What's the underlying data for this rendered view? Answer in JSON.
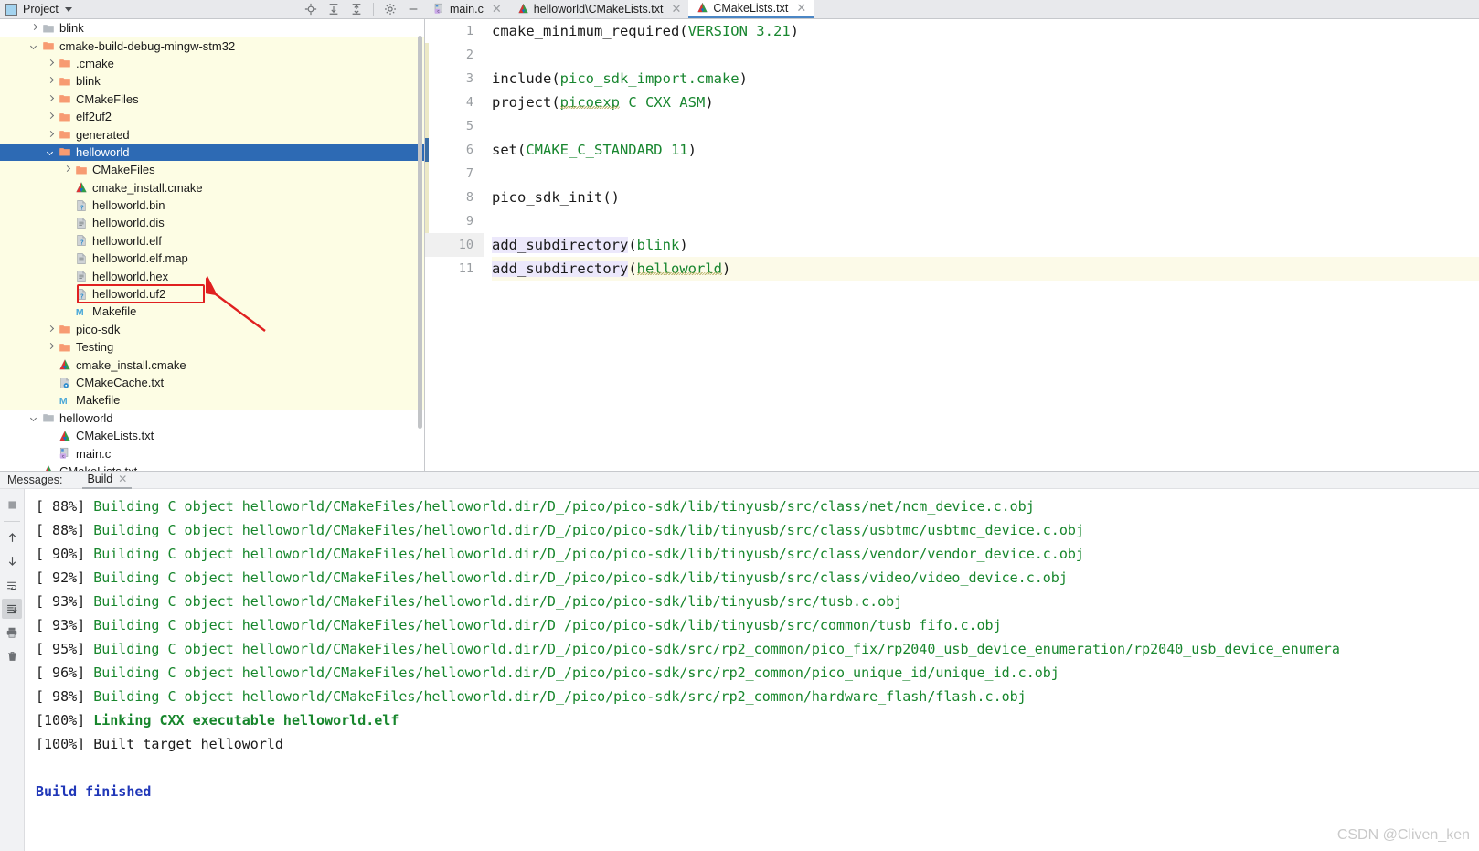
{
  "window": {
    "project_panel_title": "Project",
    "header_icons": [
      "locate-icon",
      "expand-all-icon",
      "collapse-all-icon",
      "gear-icon",
      "minimize-icon"
    ]
  },
  "editor_tabs": [
    {
      "label": "main.c",
      "icon": "c-file-icon",
      "active": false
    },
    {
      "label": "helloworld\\CMakeLists.txt",
      "icon": "cmake-file-icon",
      "active": false
    },
    {
      "label": "CMakeLists.txt",
      "icon": "cmake-file-icon",
      "active": true
    }
  ],
  "tree": {
    "items": [
      {
        "label": "blink",
        "icon": "folder-gray-icon",
        "indent": 1,
        "arrow": "right",
        "hl": false,
        "sel": false
      },
      {
        "label": "cmake-build-debug-mingw-stm32",
        "icon": "folder-orange-icon",
        "indent": 1,
        "arrow": "down",
        "hl": true,
        "sel": false
      },
      {
        "label": ".cmake",
        "icon": "folder-orange-icon",
        "indent": 2,
        "arrow": "right",
        "hl": true,
        "sel": false
      },
      {
        "label": "blink",
        "icon": "folder-orange-icon",
        "indent": 2,
        "arrow": "right",
        "hl": true,
        "sel": false
      },
      {
        "label": "CMakeFiles",
        "icon": "folder-orange-icon",
        "indent": 2,
        "arrow": "right",
        "hl": true,
        "sel": false
      },
      {
        "label": "elf2uf2",
        "icon": "folder-orange-icon",
        "indent": 2,
        "arrow": "right",
        "hl": true,
        "sel": false
      },
      {
        "label": "generated",
        "icon": "folder-orange-icon",
        "indent": 2,
        "arrow": "right",
        "hl": true,
        "sel": false
      },
      {
        "label": "helloworld",
        "icon": "folder-orange-icon",
        "indent": 2,
        "arrow": "down",
        "hl": false,
        "sel": true
      },
      {
        "label": "CMakeFiles",
        "icon": "folder-orange-icon",
        "indent": 3,
        "arrow": "right",
        "hl": true,
        "sel": false
      },
      {
        "label": "cmake_install.cmake",
        "icon": "cmake-file-icon",
        "indent": 3,
        "arrow": "none",
        "hl": true,
        "sel": false
      },
      {
        "label": "helloworld.bin",
        "icon": "unknown-file-icon",
        "indent": 3,
        "arrow": "none",
        "hl": true,
        "sel": false
      },
      {
        "label": "helloworld.dis",
        "icon": "text-file-icon",
        "indent": 3,
        "arrow": "none",
        "hl": true,
        "sel": false
      },
      {
        "label": "helloworld.elf",
        "icon": "unknown-file-icon",
        "indent": 3,
        "arrow": "none",
        "hl": true,
        "sel": false
      },
      {
        "label": "helloworld.elf.map",
        "icon": "text-file-icon",
        "indent": 3,
        "arrow": "none",
        "hl": true,
        "sel": false
      },
      {
        "label": "helloworld.hex",
        "icon": "text-file-icon",
        "indent": 3,
        "arrow": "none",
        "hl": true,
        "sel": false
      },
      {
        "label": "helloworld.uf2",
        "icon": "unknown-file-icon",
        "indent": 3,
        "arrow": "none",
        "hl": true,
        "sel": false,
        "highlighted_box": true
      },
      {
        "label": "Makefile",
        "icon": "makefile-icon",
        "indent": 3,
        "arrow": "none",
        "hl": true,
        "sel": false
      },
      {
        "label": "pico-sdk",
        "icon": "folder-orange-icon",
        "indent": 2,
        "arrow": "right",
        "hl": true,
        "sel": false
      },
      {
        "label": "Testing",
        "icon": "folder-orange-icon",
        "indent": 2,
        "arrow": "right",
        "hl": true,
        "sel": false
      },
      {
        "label": "cmake_install.cmake",
        "icon": "cmake-file-icon",
        "indent": 2,
        "arrow": "none",
        "hl": true,
        "sel": false
      },
      {
        "label": "CMakeCache.txt",
        "icon": "cache-file-icon",
        "indent": 2,
        "arrow": "none",
        "hl": true,
        "sel": false
      },
      {
        "label": "Makefile",
        "icon": "makefile-icon",
        "indent": 2,
        "arrow": "none",
        "hl": true,
        "sel": false
      },
      {
        "label": "helloworld",
        "icon": "folder-gray-icon",
        "indent": 1,
        "arrow": "down",
        "hl": false,
        "sel": false
      },
      {
        "label": "CMakeLists.txt",
        "icon": "cmake-file-icon",
        "indent": 2,
        "arrow": "none",
        "hl": false,
        "sel": false
      },
      {
        "label": "main.c",
        "icon": "c-file-icon",
        "indent": 2,
        "arrow": "none",
        "hl": false,
        "sel": false
      },
      {
        "label": "CMakeLists.txt",
        "icon": "cmake-file-icon",
        "indent": 1,
        "arrow": "none",
        "hl": false,
        "sel": false
      }
    ]
  },
  "code": {
    "line_numbers": [
      "1",
      "2",
      "3",
      "4",
      "5",
      "6",
      "7",
      "8",
      "9",
      "10",
      "11"
    ],
    "caret_line": 11,
    "lines": [
      "cmake_minimum_required(VERSION 3.21)",
      "",
      "include(pico_sdk_import.cmake)",
      "project(picoexp C CXX ASM)",
      "",
      "set(CMAKE_C_STANDARD 11)",
      "",
      "pico_sdk_init()",
      "",
      "add_subdirectory(blink)",
      "add_subdirectory(helloworld)"
    ]
  },
  "messages": {
    "label": "Messages:",
    "tab_label": "Build",
    "toolbar_icons": [
      "stop-icon",
      "scroll-up-icon",
      "scroll-down-icon",
      "soft-wrap-icon",
      "scroll-to-end-icon",
      "print-icon",
      "delete-icon"
    ]
  },
  "build_log": {
    "lines": [
      {
        "pct": "[ 88%]",
        "text": " Building C object helloworld/CMakeFiles/helloworld.dir/D_/pico/pico-sdk/lib/tinyusb/src/class/net/ncm_device.c.obj",
        "style": "green"
      },
      {
        "pct": "[ 88%]",
        "text": " Building C object helloworld/CMakeFiles/helloworld.dir/D_/pico/pico-sdk/lib/tinyusb/src/class/usbtmc/usbtmc_device.c.obj",
        "style": "green"
      },
      {
        "pct": "[ 90%]",
        "text": " Building C object helloworld/CMakeFiles/helloworld.dir/D_/pico/pico-sdk/lib/tinyusb/src/class/vendor/vendor_device.c.obj",
        "style": "green"
      },
      {
        "pct": "[ 92%]",
        "text": " Building C object helloworld/CMakeFiles/helloworld.dir/D_/pico/pico-sdk/lib/tinyusb/src/class/video/video_device.c.obj",
        "style": "green"
      },
      {
        "pct": "[ 93%]",
        "text": " Building C object helloworld/CMakeFiles/helloworld.dir/D_/pico/pico-sdk/lib/tinyusb/src/tusb.c.obj",
        "style": "green"
      },
      {
        "pct": "[ 93%]",
        "text": " Building C object helloworld/CMakeFiles/helloworld.dir/D_/pico/pico-sdk/lib/tinyusb/src/common/tusb_fifo.c.obj",
        "style": "green"
      },
      {
        "pct": "[ 95%]",
        "text": " Building C object helloworld/CMakeFiles/helloworld.dir/D_/pico/pico-sdk/src/rp2_common/pico_fix/rp2040_usb_device_enumeration/rp2040_usb_device_enumera",
        "style": "green"
      },
      {
        "pct": "[ 96%]",
        "text": " Building C object helloworld/CMakeFiles/helloworld.dir/D_/pico/pico-sdk/src/rp2_common/pico_unique_id/unique_id.c.obj",
        "style": "green"
      },
      {
        "pct": "[ 98%]",
        "text": " Building C object helloworld/CMakeFiles/helloworld.dir/D_/pico/pico-sdk/src/rp2_common/hardware_flash/flash.c.obj",
        "style": "green"
      },
      {
        "pct": "[100%]",
        "text": " Linking CXX executable helloworld.elf",
        "style": "green-bold"
      },
      {
        "pct": "[100%]",
        "text": " Built target helloworld",
        "style": "dark"
      },
      {
        "pct": "",
        "text": "",
        "style": "dark"
      },
      {
        "pct": "",
        "text": "Build finished",
        "style": "blue"
      }
    ]
  },
  "watermark": "CSDN @Cliven_ken",
  "colors": {
    "selection_blue": "#2d6ab4",
    "highlight_yellow": "#fdfde4",
    "annotation_red": "#e02020",
    "log_green": "#17862c",
    "log_blue": "#2037b8"
  }
}
